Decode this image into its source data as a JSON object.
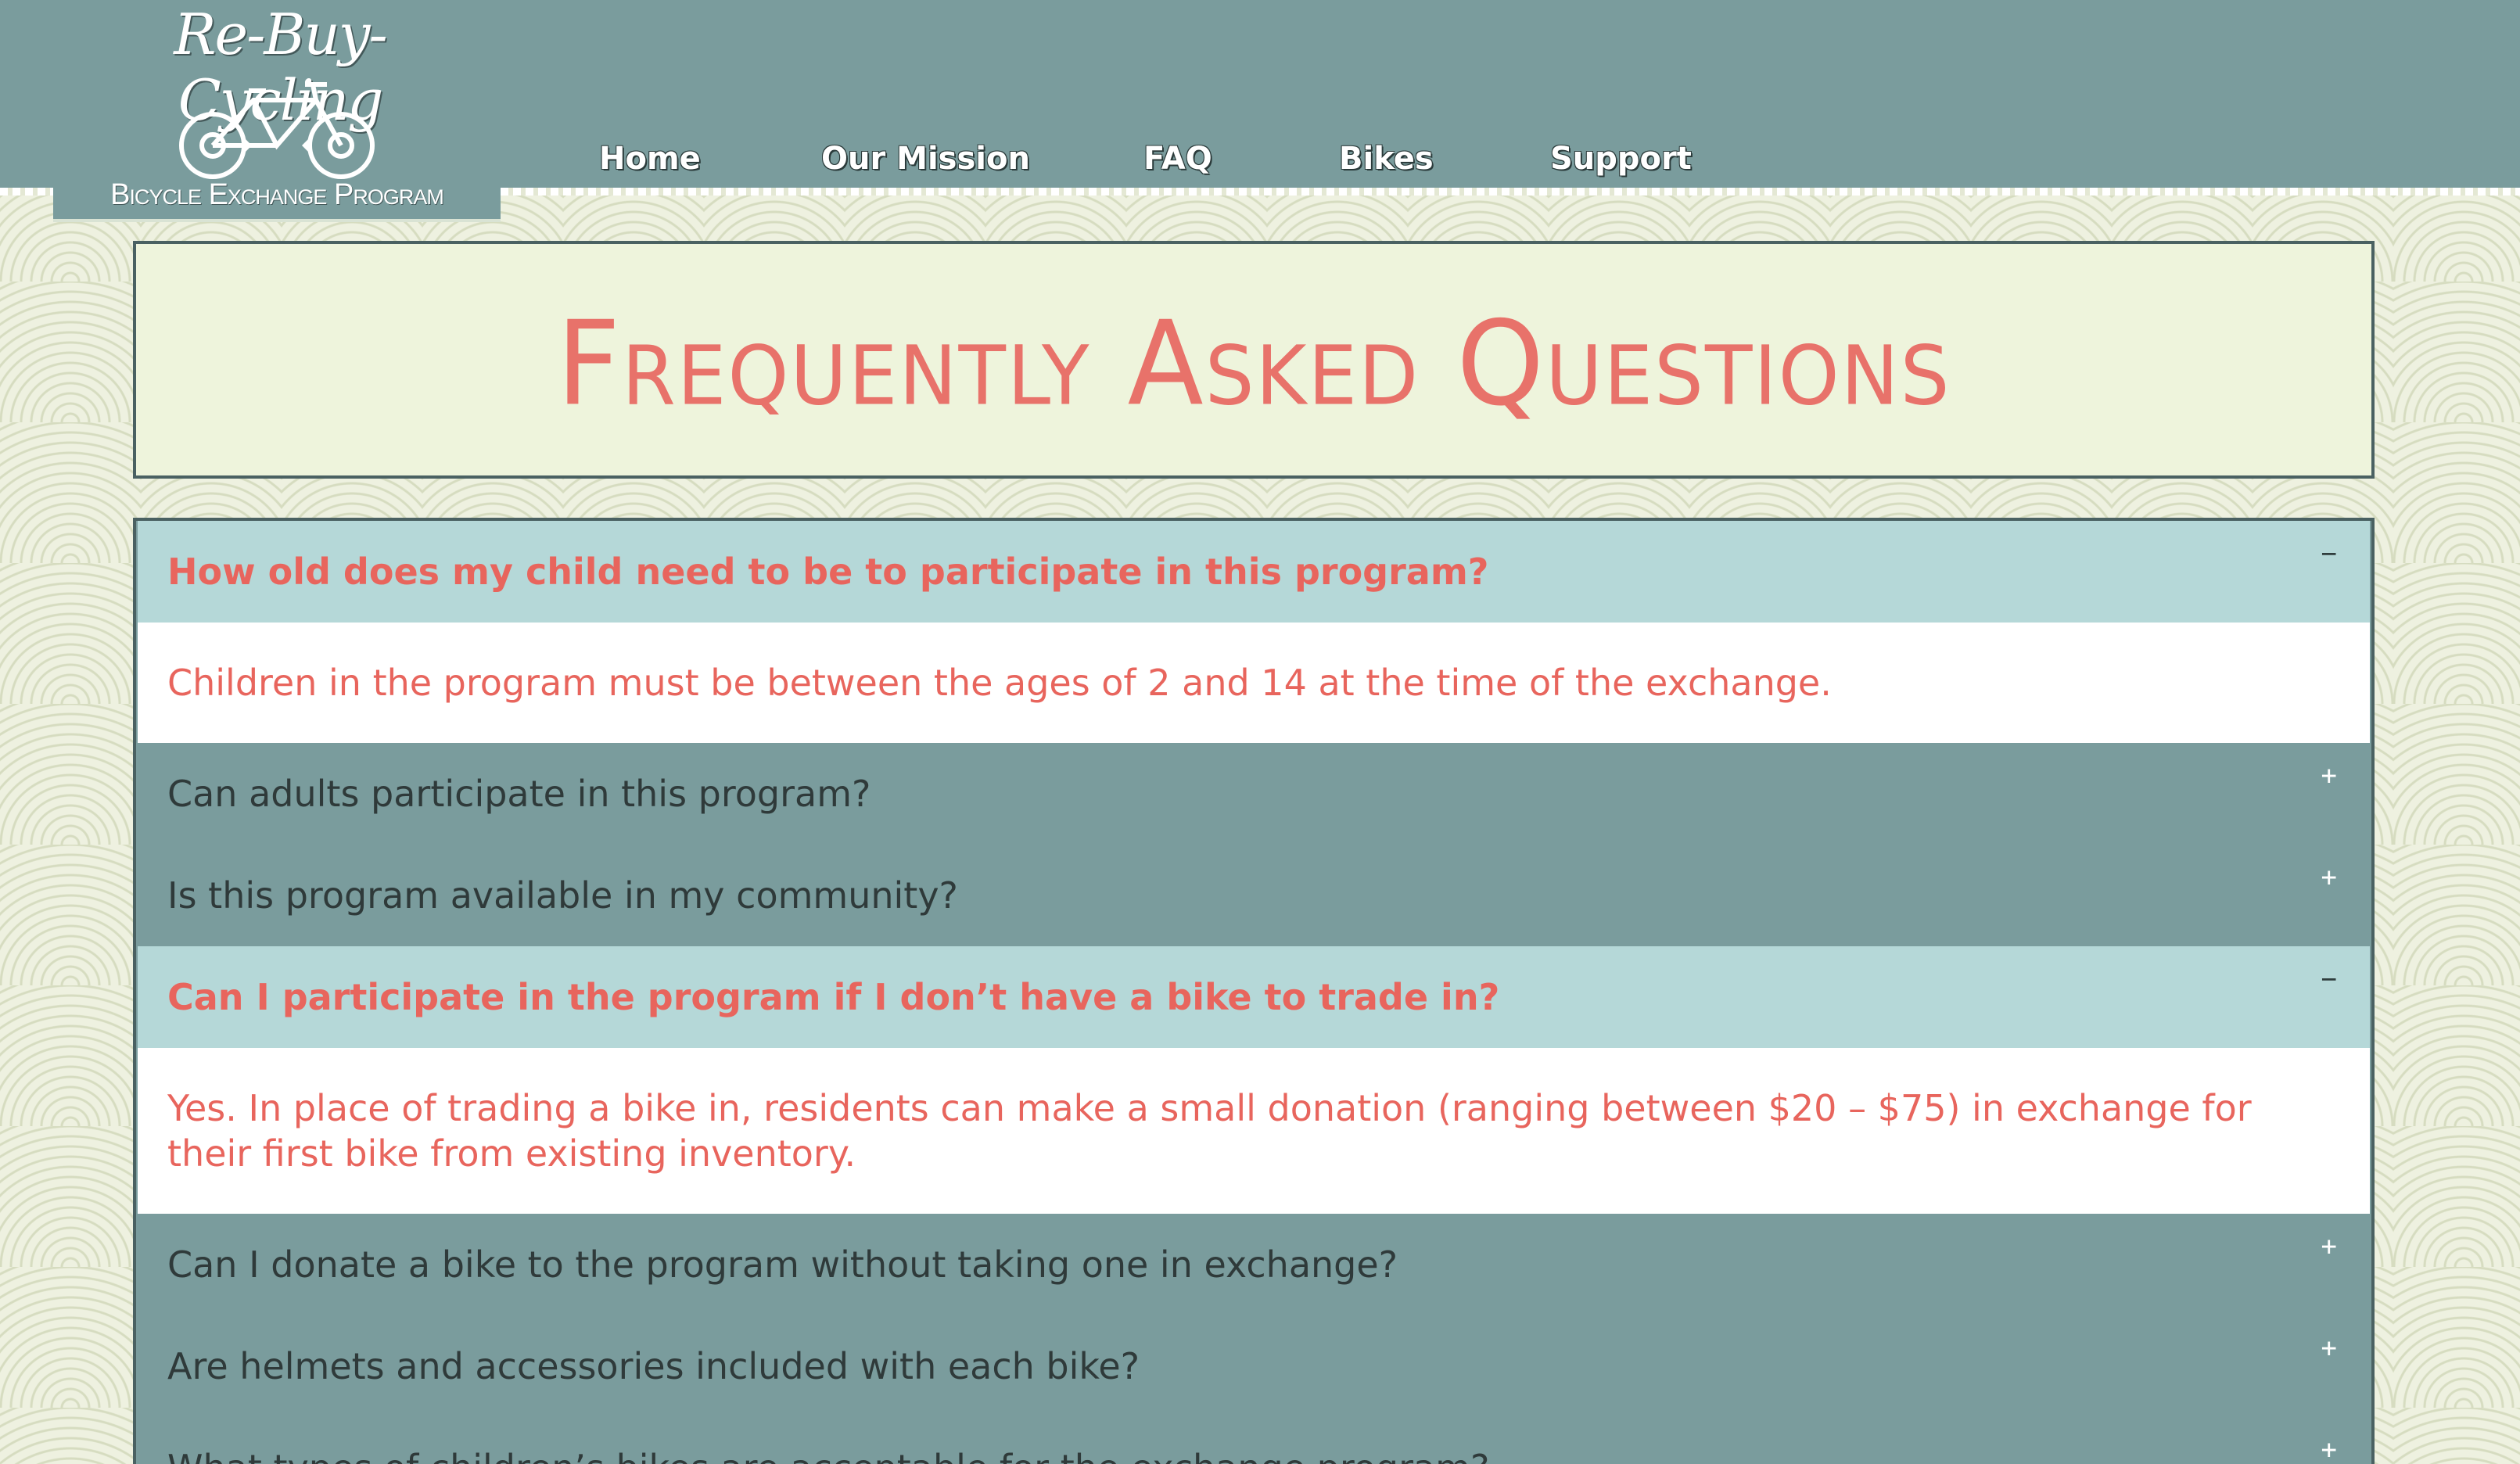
{
  "logo": {
    "script": "Re-Buy-Cycling",
    "subtitle": "Bicycle Exchange Program",
    "icon": "bicycle-recycle-icon"
  },
  "nav": {
    "items": [
      {
        "label": "Home"
      },
      {
        "label": "Our Mission"
      },
      {
        "label": "FAQ"
      },
      {
        "label": "Bikes"
      },
      {
        "label": "Support"
      }
    ]
  },
  "page": {
    "title": "Frequently Asked Questions"
  },
  "faq": {
    "items": [
      {
        "question": "How old does my child need to be to participate in this program?",
        "answer": "Children in the program must be between the ages of 2 and 14 at the time of the exchange.",
        "expanded": true,
        "toggle": "−"
      },
      {
        "question": "Can adults participate in this program?",
        "expanded": false,
        "toggle": "+"
      },
      {
        "question": "Is this program available in my community?",
        "expanded": false,
        "toggle": "+"
      },
      {
        "question": "Can I participate in the program if I don’t have a bike to trade in?",
        "answer": "Yes. In place of trading a bike in, residents can make a small donation (ranging between $20 – $75) in exchange for their first bike from existing inventory.",
        "expanded": true,
        "toggle": "−"
      },
      {
        "question": "Can I donate a bike to the program without taking one in exchange?",
        "expanded": false,
        "toggle": "+"
      },
      {
        "question": "Are helmets and accessories included with each bike?",
        "expanded": false,
        "toggle": "+"
      },
      {
        "question": "What types of children’s bikes are acceptable for the exchange program?",
        "expanded": false,
        "toggle": "+"
      }
    ]
  },
  "colors": {
    "header": "#7a9c9d",
    "accent": "#e8726a",
    "open_question_bg": "#b5d8d8",
    "title_bg": "#eef4dc"
  }
}
